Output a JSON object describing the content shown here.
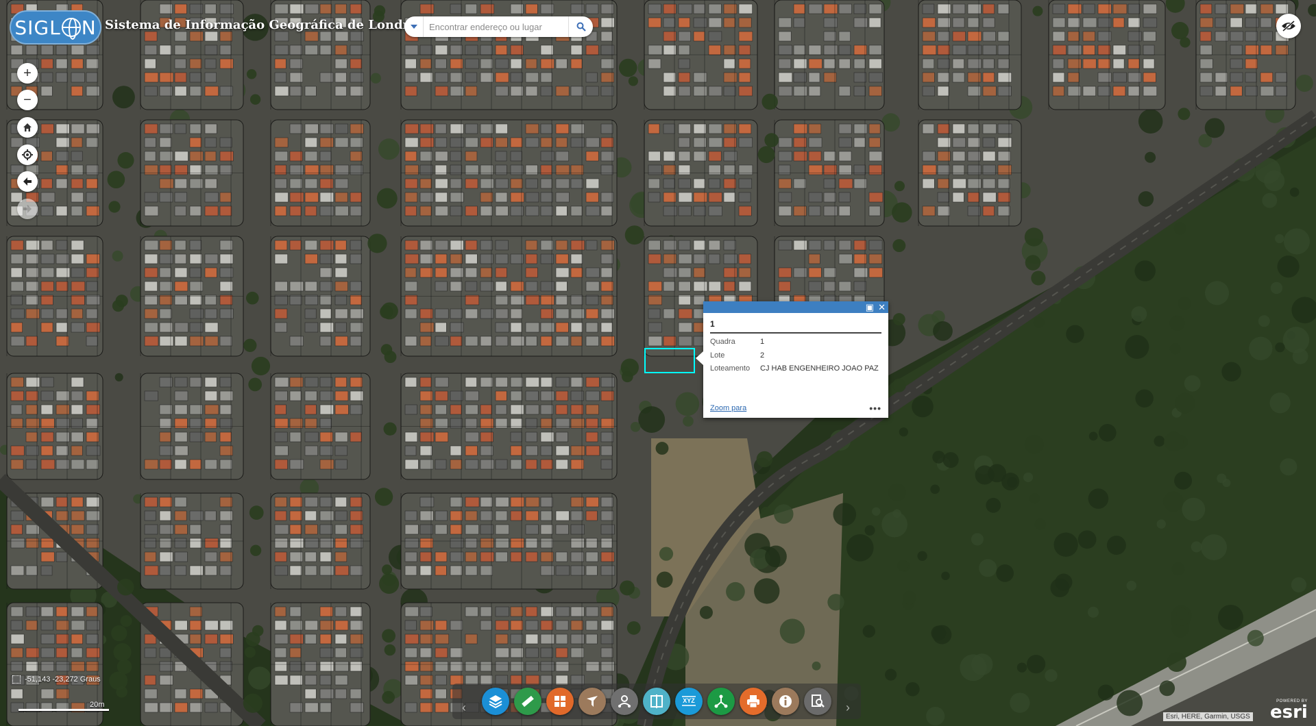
{
  "header": {
    "logo_text": "SIGLON",
    "title": "Sistema de Informação Geográfica de Londrina"
  },
  "search": {
    "placeholder": "Encontrar endereço ou lugar"
  },
  "map_nav": {
    "zoom_in": "+",
    "zoom_out": "−"
  },
  "popup": {
    "title": "1",
    "fields": [
      {
        "label": "Quadra",
        "value": "1"
      },
      {
        "label": "Lote",
        "value": "2"
      },
      {
        "label": "Loteamento",
        "value": "CJ HAB ENGENHEIRO JOAO PAZ"
      }
    ],
    "zoom_link": "Zoom para",
    "more": "•••"
  },
  "coordinates": "-51,143 -23,272 Graus",
  "scale_label": "20m",
  "toolbar": {
    "tools": [
      {
        "name": "layers-tool",
        "icon": "layers-icon",
        "color": "#1b8fd6"
      },
      {
        "name": "measure-tool",
        "icon": "ruler-icon",
        "color": "#2e9a4a"
      },
      {
        "name": "basemap-gallery-tool",
        "icon": "grid-icon",
        "color": "#e1692a"
      },
      {
        "name": "filter-tool",
        "icon": "filter-icon",
        "color": "#9c7a5c"
      },
      {
        "name": "directions-tool",
        "icon": "route-icon",
        "color": "#707070"
      },
      {
        "name": "swipe-tool",
        "icon": "swipe-icon",
        "color": "#4fb2c8"
      },
      {
        "name": "coordinate-tool",
        "icon": "xyz-icon",
        "color": "#1b9ad8"
      },
      {
        "name": "share-tool",
        "icon": "share-icon",
        "color": "#1c9a44"
      },
      {
        "name": "print-tool",
        "icon": "print-icon",
        "color": "#e46c2b"
      },
      {
        "name": "about-tool",
        "icon": "info-icon",
        "color": "#9c7a5c"
      },
      {
        "name": "query-tool",
        "icon": "zoom-doc-icon",
        "color": "#6b6b6b"
      }
    ],
    "xyz_label": "XYZ"
  },
  "attribution": "Esri, HERE, Garmin, USGS",
  "esri_logo": {
    "powered_by": "POWERED BY",
    "name": "esri"
  },
  "colors": {
    "accent": "#3d7fc1",
    "highlight": "#00ffff"
  }
}
